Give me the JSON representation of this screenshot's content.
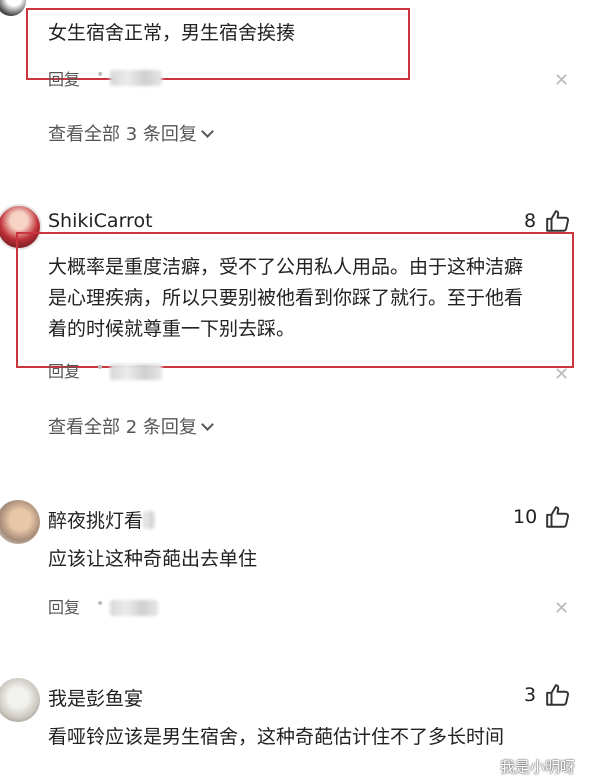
{
  "comments": [
    {
      "text": "女生宿舍正常，男生宿舍挨揍",
      "reply_label": "回复",
      "view_more": "查看全部 3 条回复"
    },
    {
      "username": "ShikiCarrot",
      "likes": "8",
      "text_lines": [
        "大概率是重度洁癖，受不了公用私人用品。由于这种洁癖",
        "是心理疾病，所以只要别被他看到你踩了就行。至于他看",
        "着的时候就尊重一下别去踩。"
      ],
      "reply_label": "回复",
      "view_more": "查看全部 2 条回复"
    },
    {
      "username": "醉夜挑灯看",
      "likes": "10",
      "text": "应该让这种奇葩出去单住",
      "reply_label": "回复"
    },
    {
      "username": "我是彭鱼宴",
      "likes": "3",
      "text": "看哑铃应该是男生宿舍，这种奇葩估计住不了多长时间"
    }
  ],
  "watermark": "我是小明呀",
  "colors": {
    "highlight_box": "#c9363e",
    "text": "#222222",
    "muted": "#555555"
  },
  "icons": [
    "thumbs-up-icon",
    "close-icon",
    "chevron-down-icon"
  ]
}
